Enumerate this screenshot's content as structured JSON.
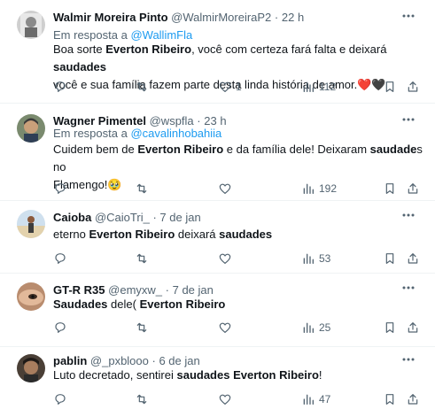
{
  "tweets": [
    {
      "name": "Walmir Moreira Pinto",
      "handle": "@WalmirMoreiraP2",
      "dot": "·",
      "time": "22 h",
      "reply_prefix": "Em resposta a",
      "reply_to": "@WallimFla",
      "segments": [
        {
          "t": "Boa sorte ",
          "b": false
        },
        {
          "t": "Everton Ribeiro",
          "b": true
        },
        {
          "t": ", você com certeza fará falta e deixará ",
          "b": false
        },
        {
          "t": "saudades",
          "b": true
        }
      ],
      "line2": "você e sua família fazem parte desta linda história de amor.",
      "emoji": "❤️🖤",
      "likes": "1",
      "views": "112"
    },
    {
      "name": "Wagner Pimentel",
      "handle": "@wspfla",
      "dot": "·",
      "time": "23 h",
      "reply_prefix": "Em resposta a",
      "reply_to": "@cavalinhobahiia",
      "segments": [
        {
          "t": "Cuidem bem de ",
          "b": false
        },
        {
          "t": "Everton Ribeiro",
          "b": true
        },
        {
          "t": " e da família dele! Deixaram ",
          "b": false
        },
        {
          "t": "saudade",
          "b": true
        },
        {
          "t": "s no",
          "b": false
        }
      ],
      "line2": "Flamengo!",
      "emoji": "🥹",
      "likes": "",
      "views": "192"
    },
    {
      "name": "Caioba",
      "handle": "@CaioTri_",
      "dot": "·",
      "time": "7 de jan",
      "segments": [
        {
          "t": "eterno ",
          "b": false
        },
        {
          "t": "Everton Ribeiro",
          "b": true
        },
        {
          "t": " deixará ",
          "b": false
        },
        {
          "t": "saudades",
          "b": true
        }
      ],
      "likes": "",
      "views": "53"
    },
    {
      "name": "GT-R R35",
      "handle": "@emyxw_",
      "dot": "·",
      "time": "7 de jan",
      "segments": [
        {
          "t": "Saudades",
          "b": true
        },
        {
          "t": " dele( ",
          "b": false
        },
        {
          "t": "Everton Ribeiro",
          "b": true
        }
      ],
      "likes": "",
      "views": "25"
    },
    {
      "name": "pablin",
      "handle": "@_pxblooo",
      "dot": "·",
      "time": "6 de jan",
      "segments": [
        {
          "t": "Luto decretado, sentirei ",
          "b": false
        },
        {
          "t": "saudades",
          "b": true
        },
        {
          "t": " ",
          "b": false
        },
        {
          "t": "Everton Ribeiro",
          "b": true
        },
        {
          "t": "!",
          "b": false
        }
      ],
      "likes": "",
      "views": "47"
    }
  ],
  "icons": {
    "more": "more-dots-icon",
    "reply": "reply-icon",
    "retweet": "retweet-icon",
    "like": "heart-icon",
    "views": "views-icon",
    "bookmark": "bookmark-icon",
    "share": "share-icon"
  },
  "colors": {
    "link": "#1d9bf0",
    "muted": "#536471",
    "text": "#0f1419"
  }
}
